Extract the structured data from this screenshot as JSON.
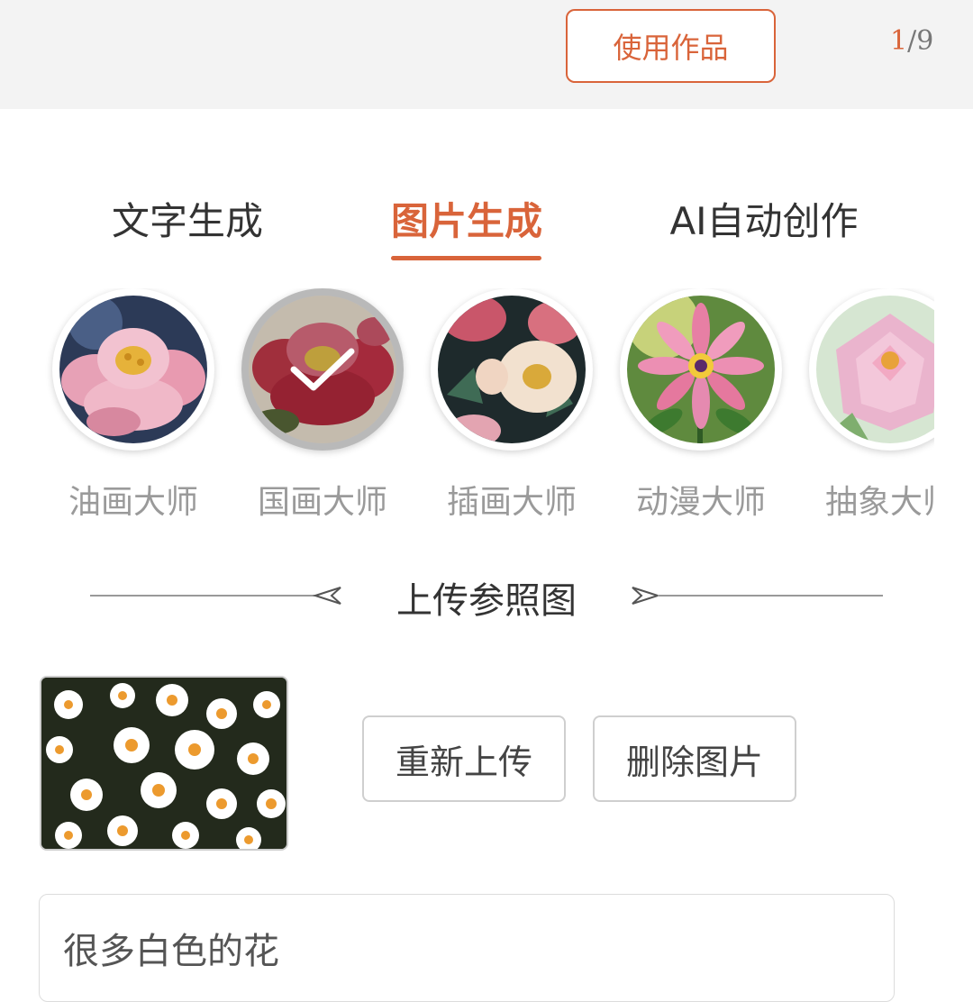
{
  "header": {
    "use_button_label": "使用作品",
    "pager_current": "1",
    "pager_total": "/9"
  },
  "tabs": [
    {
      "label": "文字生成",
      "active": false
    },
    {
      "label": "图片生成",
      "active": true
    },
    {
      "label": "AI自动创作",
      "active": false
    }
  ],
  "styles": [
    {
      "label": "油画大师",
      "selected": false,
      "icon": "peony-oil-painting"
    },
    {
      "label": "国画大师",
      "selected": true,
      "icon": "peony-chinese-painting"
    },
    {
      "label": "插画大师",
      "selected": false,
      "icon": "peony-illustration"
    },
    {
      "label": "动漫大师",
      "selected": false,
      "icon": "gerbera-anime"
    },
    {
      "label": "抽象大师",
      "selected": false,
      "icon": "peony-abstract"
    }
  ],
  "upload_section": {
    "title": "上传参照图",
    "reupload_label": "重新上传",
    "delete_label": "删除图片"
  },
  "prompt": {
    "value": "很多白色的花"
  },
  "colors": {
    "accent": "#d9643a",
    "topbar_bg": "#f3f3f3"
  }
}
